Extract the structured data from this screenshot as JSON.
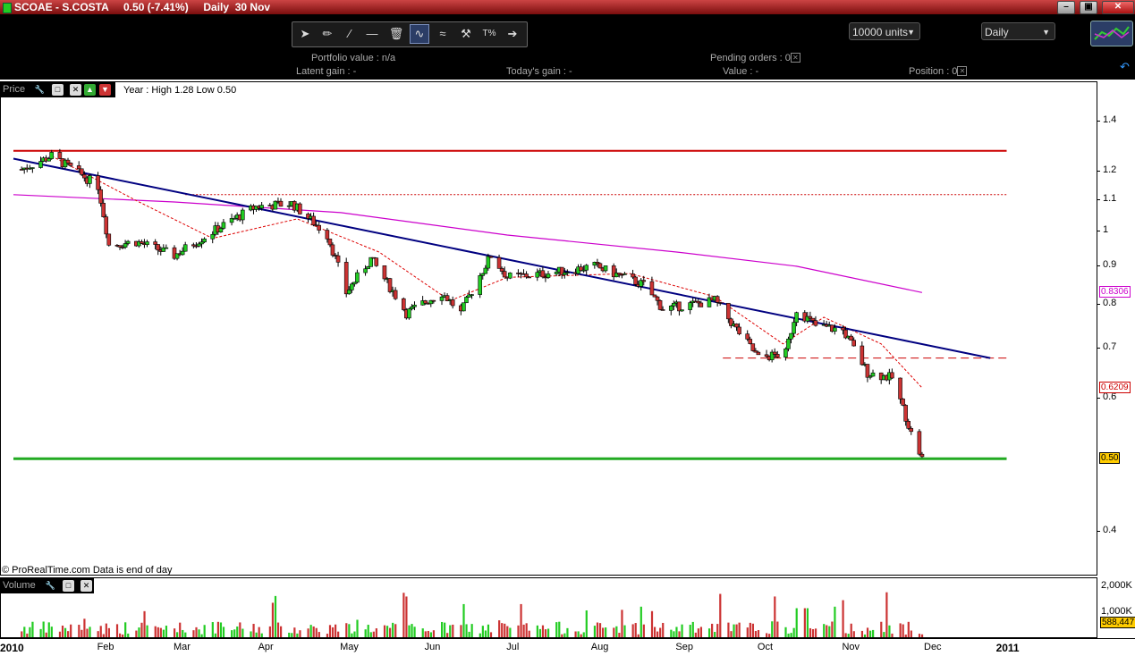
{
  "window": {
    "title": "SCOAE - S.COSTA     0.50 (-7.41%)     Daily  30 Nov"
  },
  "toolbar": {
    "tool_icons": [
      "pointer-icon",
      "pencil-icon",
      "line-icon",
      "horizontal-line-icon",
      "trash-icon",
      "indicator-icon",
      "channel-icon",
      "tools-icon",
      "percent-icon",
      "arrow-right-icon"
    ],
    "units_select": "10000 units",
    "period_select": "Daily"
  },
  "info": {
    "portfolio_value": "Portfolio value : n/a",
    "pending_orders": "Pending orders : 0",
    "latent_gain": "Latent gain : -",
    "todays_gain": "Today's gain : -",
    "value": "Value : -",
    "position": "Position : 0"
  },
  "price_pane": {
    "label": "Price",
    "year_info": "Year : High 1.28 Low 0.50",
    "credit": "© ProRealTime.com  Data is end of day",
    "tags": [
      {
        "text": "0.8306",
        "value": 0.8306,
        "color": "#cc00cc"
      },
      {
        "text": "0.6209",
        "value": 0.6209,
        "color": "#cc0000"
      },
      {
        "text": "0.50",
        "value": 0.5,
        "color": "#000000",
        "bg": "#ffcc00"
      }
    ]
  },
  "volume_pane": {
    "label": "Volume",
    "y_ticks": [
      "2,000K",
      "1,000K"
    ],
    "last_value": "588,447"
  },
  "colors": {
    "up": "#22cc22",
    "down": "#cc3333",
    "trend": "#000080",
    "ma_long": "#cc00cc",
    "ma_short": "#dd0000",
    "support": "#22aa22",
    "resistance": "#cc0000"
  },
  "chart_data": {
    "type": "candlestick",
    "title": "SCOAE - S.COSTA",
    "y_scale": "log",
    "ylim": [
      0.37,
      1.56
    ],
    "y_ticks": [
      1.4,
      1.2,
      1.1,
      1,
      0.9,
      0.8,
      0.7,
      0.6,
      0.4
    ],
    "x_ticks": [
      "2010",
      "Feb",
      "Mar",
      "Apr",
      "May",
      "Jun",
      "Jul",
      "Aug",
      "Sep",
      "Oct",
      "Nov",
      "Dec",
      "2011"
    ],
    "close_anchors": [
      {
        "date": "2010-01-04",
        "close": 1.21
      },
      {
        "date": "2010-01-15",
        "close": 1.26
      },
      {
        "date": "2010-02-01",
        "close": 1.15
      },
      {
        "date": "2010-02-05",
        "close": 0.96
      },
      {
        "date": "2010-02-15",
        "close": 0.97
      },
      {
        "date": "2010-03-01",
        "close": 0.93
      },
      {
        "date": "2010-03-15",
        "close": 1.0
      },
      {
        "date": "2010-03-31",
        "close": 1.08
      },
      {
        "date": "2010-04-13",
        "close": 1.09
      },
      {
        "date": "2010-04-26",
        "close": 0.99
      },
      {
        "date": "2010-05-03",
        "close": 0.83
      },
      {
        "date": "2010-05-12",
        "close": 0.92
      },
      {
        "date": "2010-05-25",
        "close": 0.78
      },
      {
        "date": "2010-06-07",
        "close": 0.83
      },
      {
        "date": "2010-06-14",
        "close": 0.78
      },
      {
        "date": "2010-06-25",
        "close": 0.93
      },
      {
        "date": "2010-07-01",
        "close": 0.87
      },
      {
        "date": "2010-07-15",
        "close": 0.88
      },
      {
        "date": "2010-08-02",
        "close": 0.9
      },
      {
        "date": "2010-08-20",
        "close": 0.85
      },
      {
        "date": "2010-08-27",
        "close": 0.79
      },
      {
        "date": "2010-09-15",
        "close": 0.81
      },
      {
        "date": "2010-09-22",
        "close": 0.75
      },
      {
        "date": "2010-10-01",
        "close": 0.68
      },
      {
        "date": "2010-10-11",
        "close": 0.69
      },
      {
        "date": "2010-10-15",
        "close": 0.79
      },
      {
        "date": "2010-10-22",
        "close": 0.75
      },
      {
        "date": "2010-11-01",
        "close": 0.74
      },
      {
        "date": "2010-11-10",
        "close": 0.65
      },
      {
        "date": "2010-11-19",
        "close": 0.64
      },
      {
        "date": "2010-11-26",
        "close": 0.54
      },
      {
        "date": "2010-11-30",
        "close": 0.5
      }
    ],
    "series": [
      {
        "name": "MA long",
        "points": [
          [
            "2010-01-01",
            1.12
          ],
          [
            "2010-03-01",
            1.095
          ],
          [
            "2010-05-01",
            1.06
          ],
          [
            "2010-07-01",
            0.99
          ],
          [
            "2010-09-01",
            0.94
          ],
          [
            "2010-10-15",
            0.9
          ],
          [
            "2010-11-30",
            0.8306
          ]
        ]
      },
      {
        "name": "MA short",
        "points": [
          [
            "2010-01-15",
            1.26
          ],
          [
            "2010-02-15",
            1.1
          ],
          [
            "2010-03-15",
            0.98
          ],
          [
            "2010-04-15",
            1.04
          ],
          [
            "2010-05-15",
            0.94
          ],
          [
            "2010-06-10",
            0.81
          ],
          [
            "2010-07-01",
            0.87
          ],
          [
            "2010-08-15",
            0.88
          ],
          [
            "2010-09-15",
            0.82
          ],
          [
            "2010-10-10",
            0.71
          ],
          [
            "2010-10-25",
            0.77
          ],
          [
            "2010-11-15",
            0.71
          ],
          [
            "2010-11-30",
            0.6209
          ]
        ]
      },
      {
        "name": "Trend line",
        "points": [
          [
            "2010-01-01",
            1.25
          ],
          [
            "2010-12-25",
            0.68
          ]
        ]
      },
      {
        "name": "Resistance",
        "points": [
          [
            "2010-01-01",
            1.28
          ],
          [
            "2010-12-31",
            1.28
          ]
        ]
      },
      {
        "name": "Support",
        "points": [
          [
            "2010-01-01",
            0.5
          ],
          [
            "2010-12-31",
            0.5
          ]
        ]
      },
      {
        "name": "Dotted level",
        "points": [
          [
            "2010-03-05",
            1.12
          ],
          [
            "2010-12-31",
            1.12
          ]
        ]
      },
      {
        "name": "Dashed level",
        "points": [
          [
            "2010-09-18",
            0.68
          ],
          [
            "2010-12-31",
            0.68
          ]
        ]
      }
    ],
    "volume": {
      "max_tick": 2000000,
      "last": 588447,
      "peak": 2100000
    }
  }
}
